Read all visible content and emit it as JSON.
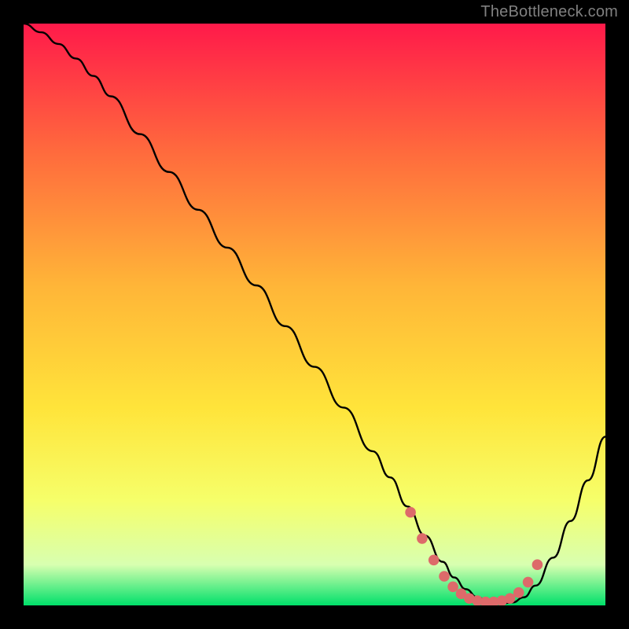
{
  "watermark": "TheBottleneck.com",
  "colors": {
    "bg": "#000000",
    "curve": "#000000",
    "marker": "#dd6a6a",
    "grad_top": "#ff1a4a",
    "grad_mid1": "#ff6a3d",
    "grad_mid2": "#ffb538",
    "grad_mid3": "#ffe43a",
    "grad_mid4": "#f6ff6a",
    "grad_mid5": "#d8ffb0",
    "grad_bottom": "#00e06a"
  },
  "chart_data": {
    "type": "line",
    "title": "",
    "xlabel": "",
    "ylabel": "",
    "xlim": [
      0,
      100
    ],
    "ylim": [
      0,
      100
    ],
    "series": [
      {
        "name": "curve",
        "x": [
          0,
          3,
          6,
          9,
          12,
          15,
          20,
          25,
          30,
          35,
          40,
          45,
          50,
          55,
          60,
          63,
          66,
          69,
          72,
          74,
          76,
          78,
          80,
          82,
          84,
          86,
          88,
          91,
          94,
          97,
          100
        ],
        "y": [
          100,
          98.5,
          96.5,
          94,
          91,
          87.5,
          81,
          74.5,
          68,
          61.5,
          55,
          48,
          41,
          34,
          26.5,
          22,
          17,
          12,
          7.5,
          4.8,
          2.8,
          1.4,
          0.6,
          0.3,
          0.5,
          1.4,
          3.4,
          8.2,
          14.5,
          21.5,
          29
        ]
      }
    ],
    "markers": {
      "name": "optimal-range-dots",
      "x": [
        66.5,
        68.5,
        70.5,
        72.3,
        73.8,
        75.2,
        76.6,
        78.0,
        79.4,
        80.8,
        82.2,
        83.6,
        85.1,
        86.7,
        88.3
      ],
      "y": [
        16.0,
        11.5,
        7.8,
        5.0,
        3.2,
        2.0,
        1.2,
        0.8,
        0.6,
        0.6,
        0.8,
        1.2,
        2.2,
        4.0,
        7.0
      ]
    }
  }
}
